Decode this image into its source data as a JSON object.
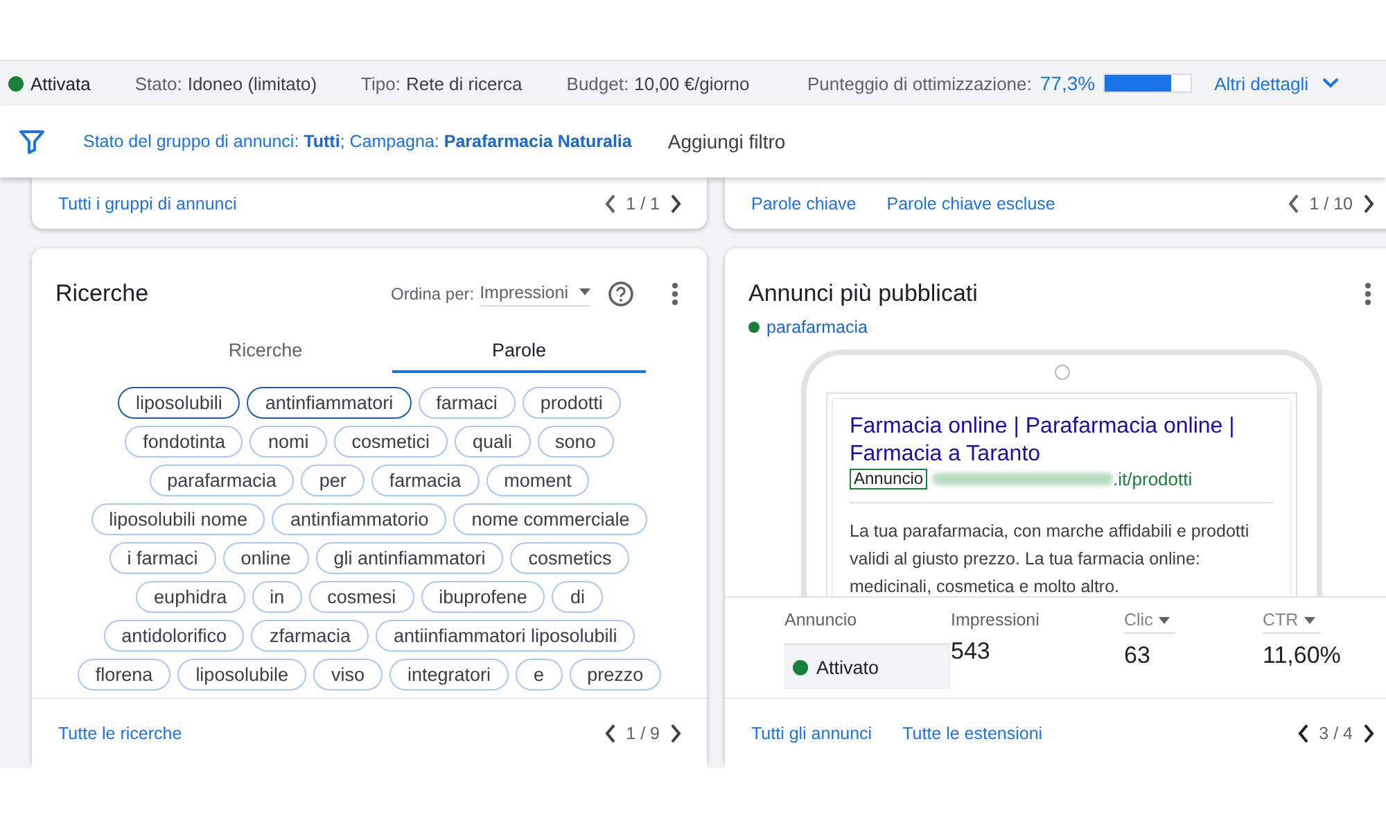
{
  "status_bar": {
    "status": {
      "label": "Attivata",
      "color": "#188038"
    },
    "items": [
      {
        "label": "Stato:",
        "value": "Idoneo (limitato)"
      },
      {
        "label": "Tipo:",
        "value": "Rete di ricerca"
      },
      {
        "label": "Budget:",
        "value": "10,00 €/giorno"
      }
    ],
    "optimization": {
      "label": "Punteggio di ottimizzazione:",
      "value": "77,3%",
      "level": 0.773
    },
    "details_link": "Altri dettagli"
  },
  "filter_bar": {
    "filter": "Stato del gruppo di annunci: **Tutti**; Campagna: **Parafarmacia Naturalia**",
    "add_filter": "Aggiungi filtro"
  },
  "top_cards": [
    {
      "links": [
        "Tutti i gruppi di annunci"
      ],
      "pager": "1 / 1"
    },
    {
      "links": [
        "Parole chiave",
        "Parole chiave escluse"
      ],
      "pager": "1 / 10"
    }
  ],
  "searches_card": {
    "title": "Ricerche",
    "sort_label": "Ordina per:",
    "sort_value": "Impressioni",
    "tabs": [
      {
        "label": "Ricerche",
        "selected": false
      },
      {
        "label": "Parole",
        "selected": true
      }
    ],
    "chip_rows": [
      [
        {
          "label": "liposolubili",
          "selected": true
        },
        {
          "label": "antinfiammatori",
          "selected": true
        },
        {
          "label": "farmaci",
          "selected": false
        },
        {
          "label": "prodotti",
          "selected": false
        }
      ],
      [
        {
          "label": "fondotinta",
          "selected": false
        },
        {
          "label": "nomi",
          "selected": false
        },
        {
          "label": "cosmetici",
          "selected": false
        },
        {
          "label": "quali",
          "selected": false
        },
        {
          "label": "sono",
          "selected": false
        }
      ],
      [
        {
          "label": "parafarmacia",
          "selected": false
        },
        {
          "label": "per",
          "selected": false
        },
        {
          "label": "farmacia",
          "selected": false
        },
        {
          "label": "moment",
          "selected": false
        }
      ],
      [
        {
          "label": "liposolubili nome",
          "selected": false
        },
        {
          "label": "antinfiammatorio",
          "selected": false
        },
        {
          "label": "nome commerciale",
          "selected": false
        }
      ],
      [
        {
          "label": "i farmaci",
          "selected": false
        },
        {
          "label": "online",
          "selected": false
        },
        {
          "label": "gli antinfiammatori",
          "selected": false
        },
        {
          "label": "cosmetics",
          "selected": false
        }
      ],
      [
        {
          "label": "euphidra",
          "selected": false
        },
        {
          "label": "in",
          "selected": false
        },
        {
          "label": "cosmesi",
          "selected": false
        },
        {
          "label": "ibuprofene",
          "selected": false
        },
        {
          "label": "di",
          "selected": false
        }
      ],
      [
        {
          "label": "antidolorifico",
          "selected": false
        },
        {
          "label": "zfarmacia",
          "selected": false
        },
        {
          "label": "antiinfiammatori liposolubili",
          "selected": false
        }
      ],
      [
        {
          "label": "florena",
          "selected": false
        },
        {
          "label": "liposolubile",
          "selected": false
        },
        {
          "label": "viso",
          "selected": false
        },
        {
          "label": "integratori",
          "selected": false
        },
        {
          "label": "e",
          "selected": false
        },
        {
          "label": "prezzo",
          "selected": false
        }
      ]
    ],
    "footer_link": "Tutte le ricerche",
    "pager": "1 / 9"
  },
  "ads_card": {
    "title": "Annunci più pubblicati",
    "ad_group": {
      "label": "parafarmacia",
      "color": "#188038"
    },
    "ad": {
      "headline": "Farmacia online | Parafarmacia online | Farmacia a Taranto",
      "badge": "Annuncio",
      "url": ".it/prodotti",
      "description": "La tua parafarmacia, con marche affidabili e prodotti validi al giusto prezzo. La tua farmacia online: medicinali, cosmetica e molto altro."
    },
    "stats": [
      {
        "kind": "status",
        "label": "Annuncio",
        "value": "Attivato",
        "color": "#188038",
        "sortable": false
      },
      {
        "kind": "number",
        "label": "Impressioni",
        "value": "543",
        "sortable": false
      },
      {
        "kind": "number",
        "label": "Clic",
        "value": "63",
        "sortable": true
      },
      {
        "kind": "number",
        "label": "CTR",
        "value": "11,60%",
        "sortable": true
      }
    ],
    "footer_links": [
      "Tutti gli annunci",
      "Tutte le estensioni"
    ],
    "pager": "3 / 4"
  }
}
